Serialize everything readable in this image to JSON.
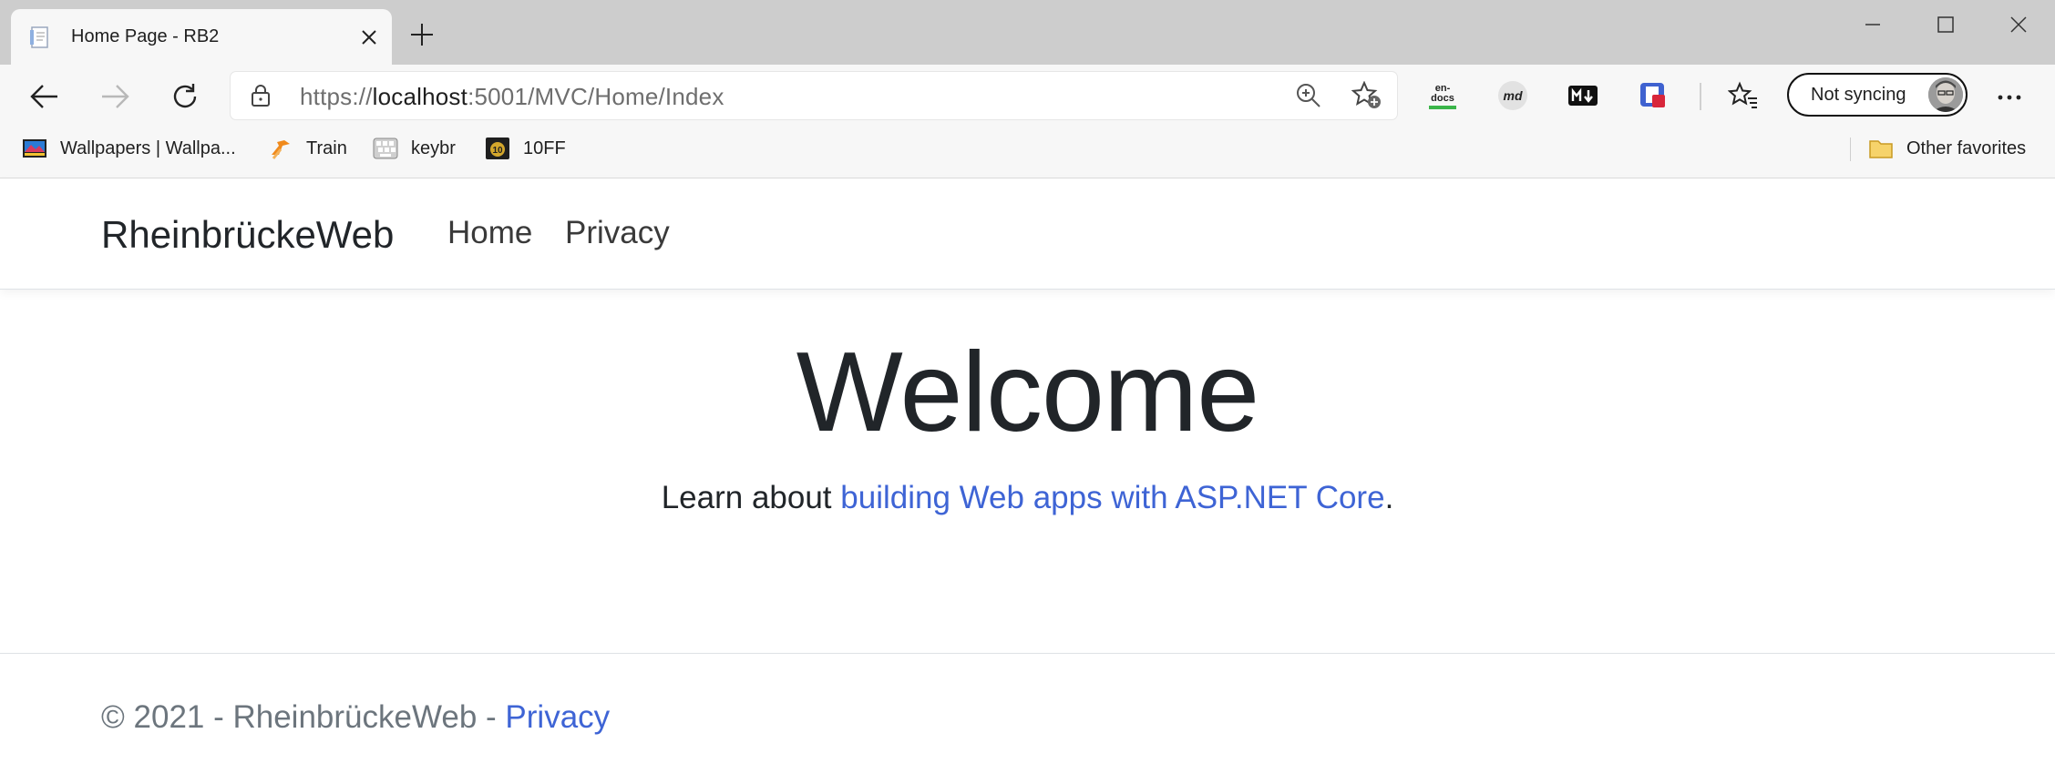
{
  "browser": {
    "tab": {
      "title": "Home Page - RB2"
    },
    "address": {
      "url_scheme": "https://",
      "url_host": "localhost",
      "url_rest": ":5001/MVC/Home/Index"
    },
    "profile": {
      "label": "Not syncing"
    },
    "extensions": [
      "en-docs",
      "md",
      "markdown-viewer",
      "extension-red"
    ],
    "bookmarks": [
      {
        "label": "Wallpapers | Wallpa...",
        "icon": "wallpapers-favicon"
      },
      {
        "label": "Train",
        "icon": "train-favicon"
      },
      {
        "label": "keybr",
        "icon": "keybr-favicon"
      },
      {
        "label": "10FF",
        "icon": "10ff-favicon"
      }
    ],
    "other_favorites": "Other favorites"
  },
  "site": {
    "brand": "RheinbrückeWeb",
    "nav": [
      "Home",
      "Privacy"
    ],
    "hero": {
      "title": "Welcome",
      "lead_prefix": "Learn about ",
      "lead_link": "building Web apps with ASP.NET Core",
      "lead_suffix": "."
    },
    "footer": {
      "text": "© 2021 - RheinbrückeWeb - ",
      "link": "Privacy"
    }
  },
  "colors": {
    "link": "#3e64d5",
    "titlebar": "#cdcdcd",
    "toolbar": "#f7f7f7"
  }
}
